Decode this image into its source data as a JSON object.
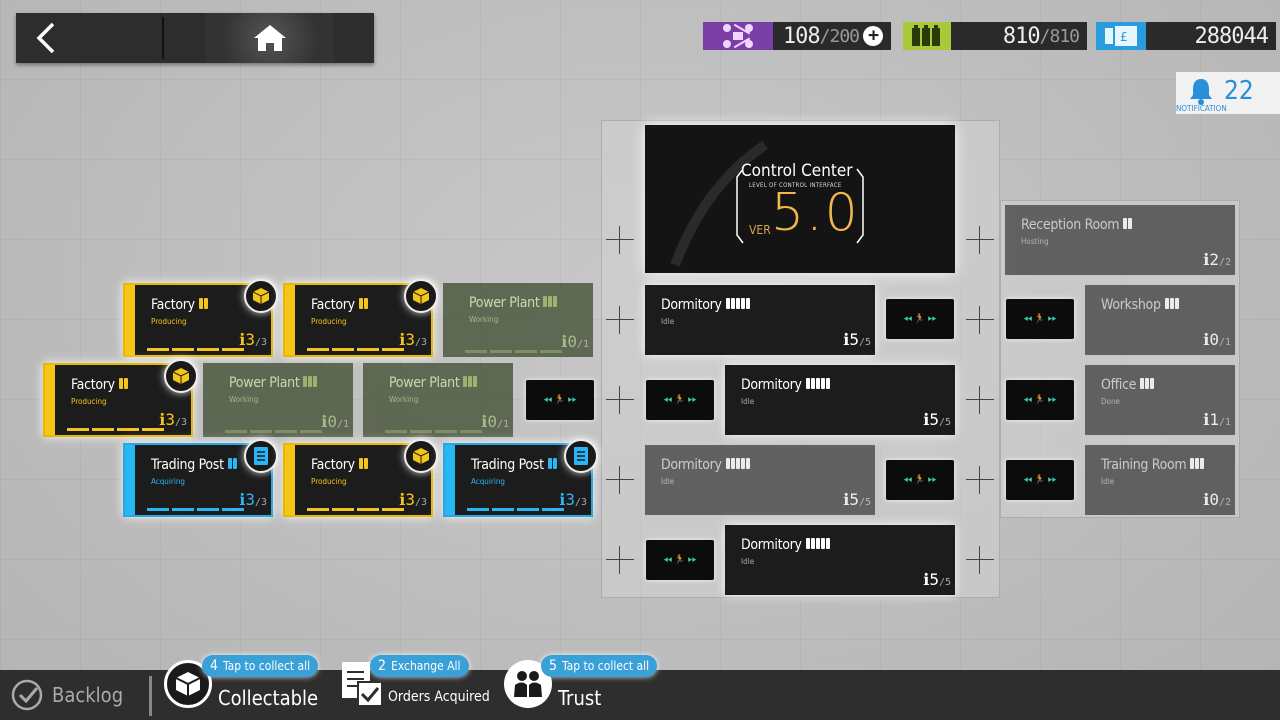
{
  "nav": {
    "back": "back",
    "home": "home"
  },
  "resources": {
    "drones": {
      "value": "108",
      "max": "/200"
    },
    "batteries": {
      "value": "810",
      "max": "/810"
    },
    "tickets": {
      "value": "288044"
    }
  },
  "notification": {
    "count": "22",
    "label": "NOTIFICATION"
  },
  "control_center": {
    "title": "Control Center",
    "subtitle": "LEVEL OF CONTROL INTERFACE",
    "ver": "VER",
    "version": "5.0"
  },
  "facilities": [
    {
      "name": "Factory",
      "status": "Producing",
      "level": "3",
      "max": "/3"
    },
    {
      "name": "Factory",
      "status": "Producing",
      "level": "3",
      "max": "/3"
    },
    {
      "name": "Power Plant",
      "status": "Working",
      "level": "0",
      "max": "/1"
    },
    {
      "name": "Factory",
      "status": "Producing",
      "level": "3",
      "max": "/3"
    },
    {
      "name": "Power Plant",
      "status": "Working",
      "level": "0",
      "max": "/1"
    },
    {
      "name": "Power Plant",
      "status": "Working",
      "level": "0",
      "max": "/1"
    },
    {
      "name": "Trading Post",
      "status": "Acquiring",
      "level": "3",
      "max": "/3"
    },
    {
      "name": "Factory",
      "status": "Producing",
      "level": "3",
      "max": "/3"
    },
    {
      "name": "Trading Post",
      "status": "Acquiring",
      "level": "3",
      "max": "/3"
    },
    {
      "name": "Dormitory",
      "status": "Idle",
      "level": "5",
      "max": "/5"
    },
    {
      "name": "Dormitory",
      "status": "Idle",
      "level": "5",
      "max": "/5"
    },
    {
      "name": "Dormitory",
      "status": "Idle",
      "level": "5",
      "max": "/5"
    },
    {
      "name": "Dormitory",
      "status": "Idle",
      "level": "5",
      "max": "/5"
    },
    {
      "name": "Reception Room",
      "status": "Hosting",
      "level": "2",
      "max": "/2"
    },
    {
      "name": "Workshop",
      "status": "",
      "level": "0",
      "max": "/1"
    },
    {
      "name": "Office",
      "status": "Done",
      "level": "1",
      "max": "/1"
    },
    {
      "name": "Training Room",
      "status": "Idle",
      "level": "0",
      "max": "/2"
    }
  ],
  "bottom": {
    "backlog": "Backlog",
    "collectable": {
      "label": "Collectable",
      "count": "4",
      "pill": "Tap to collect all"
    },
    "orders": {
      "label": "Orders Acquired",
      "count": "2",
      "pill": "Exchange All"
    },
    "trust": {
      "label": "Trust",
      "count": "5",
      "pill": "Tap to collect all"
    }
  }
}
